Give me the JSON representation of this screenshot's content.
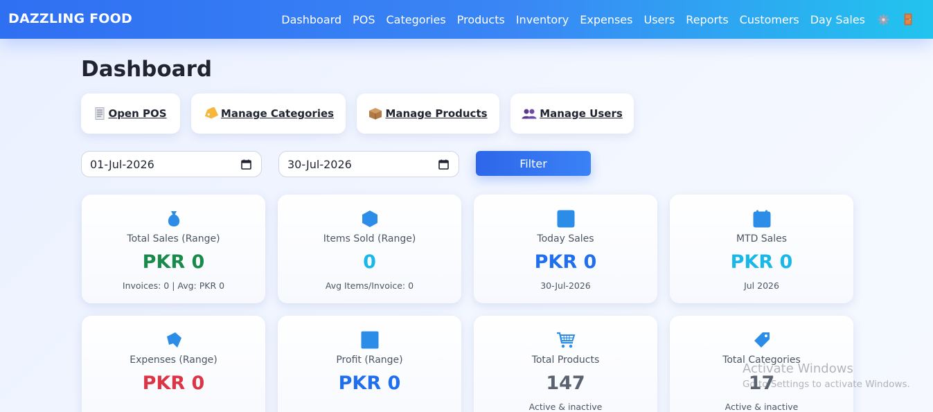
{
  "brand": "DAZZLING FOOD",
  "nav": {
    "links": [
      "Dashboard",
      "POS",
      "Categories",
      "Products",
      "Inventory",
      "Expenses",
      "Users",
      "Reports",
      "Customers",
      "Day Sales"
    ],
    "icons": [
      "gear-icon",
      "door-icon"
    ]
  },
  "page_title": "Dashboard",
  "quick_actions": [
    {
      "label": "Open POS",
      "icon": "receipt-icon"
    },
    {
      "label": "Manage Categories",
      "icon": "tag-icon"
    },
    {
      "label": "Manage Products",
      "icon": "package-icon"
    },
    {
      "label": "Manage Users",
      "icon": "users-icon"
    }
  ],
  "filters": {
    "from_date": "01-Jul-2026",
    "to_date": "30-Jul-2026",
    "filter_label": "Filter"
  },
  "cards": [
    {
      "label": "Total Sales (Range)",
      "value": "PKR 0",
      "sub": "Invoices: 0 | Avg: PKR 0",
      "icon": "money-bag-icon",
      "color": "#1a8a4a"
    },
    {
      "label": "Items Sold (Range)",
      "value": "0",
      "sub": "Avg Items/Invoice: 0",
      "icon": "cube-icon",
      "color": "#19b8e8"
    },
    {
      "label": "Today Sales",
      "value": "PKR 0",
      "sub": "30-Jul-2026",
      "icon": "calendar-day-icon",
      "color": "#1f6fee"
    },
    {
      "label": "MTD Sales",
      "value": "PKR 0",
      "sub": "Jul 2026",
      "icon": "calendar-icon",
      "color": "#19b8e8"
    },
    {
      "label": "Expenses (Range)",
      "value": "PKR 0",
      "sub": "",
      "icon": "money-wings-icon",
      "color": "#dc3545"
    },
    {
      "label": "Profit (Range)",
      "value": "PKR 0",
      "sub": "",
      "icon": "chart-icon",
      "color": "#1f6fee"
    },
    {
      "label": "Total Products",
      "value": "147",
      "sub": "Active & inactive",
      "icon": "cart-icon",
      "color": "#5b6370"
    },
    {
      "label": "Total Categories",
      "value": "17",
      "sub": "Active & inactive",
      "icon": "label-tag-icon",
      "color": "#5b6370"
    }
  ],
  "watermark": {
    "title": "Activate Windows",
    "subtitle": "Go to Settings to activate Windows."
  }
}
